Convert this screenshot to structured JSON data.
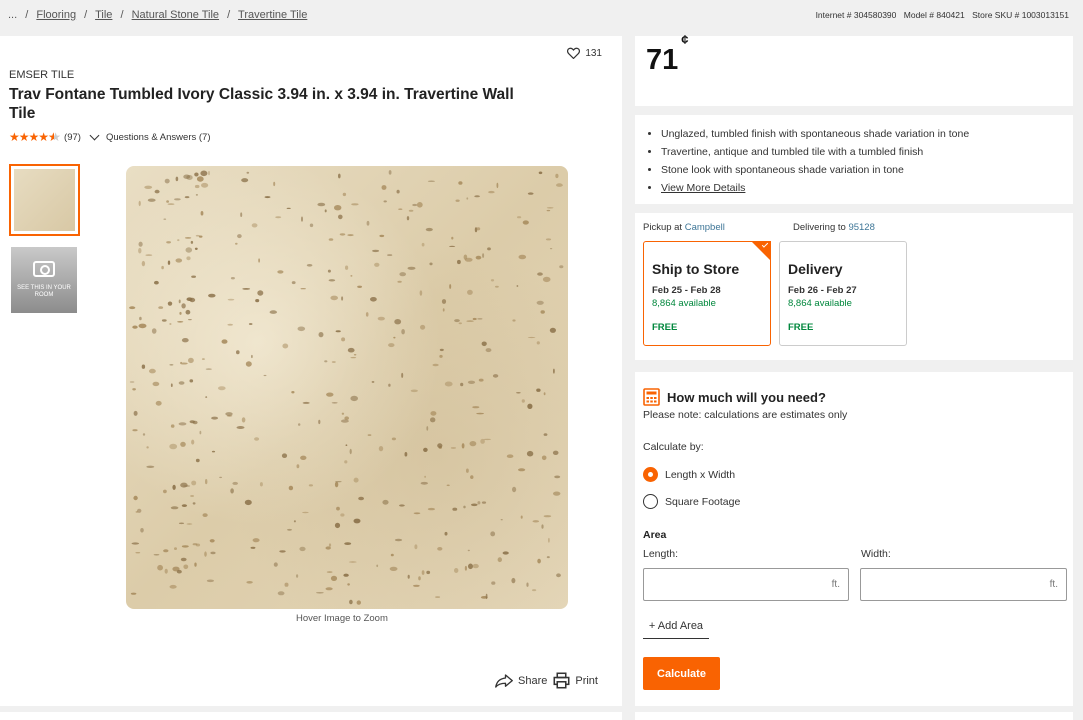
{
  "breadcrumb": {
    "ellipsis": "...",
    "separator": "/",
    "items": [
      "Flooring",
      "Tile",
      "Natural Stone Tile",
      "Travertine Tile"
    ]
  },
  "identifiers": {
    "internet": "Internet # 304580390",
    "model": "Model # 840421",
    "store_sku": "Store SKU # 1003013151"
  },
  "product": {
    "favorites_count": "131",
    "brand": "EMSER TILE",
    "title": "Trav Fontane Tumbled Ivory Classic 3.94 in. x 3.94 in. Travertine Wall Tile",
    "rating_stars": 4.5,
    "review_count": "(97)",
    "qa_label": "Questions & Answers (7)",
    "thumbnail_caption": "SEE THIS IN YOUR ROOM",
    "hover_text": "Hover Image to Zoom",
    "share_label": "Share",
    "print_label": "Print"
  },
  "price": {
    "value": "71",
    "unit": "¢"
  },
  "highlights": [
    "Unglazed, tumbled finish with spontaneous shade variation in tone",
    "Travertine, antique and tumbled tile with a tumbled finish",
    "Stone look with spontaneous shade variation in tone"
  ],
  "view_more_label": "View More Details",
  "fulfillment": {
    "pickup_prefix": "Pickup at",
    "pickup_store": "Campbell",
    "delivery_prefix": "Delivering to",
    "delivery_zip": "95128",
    "options": [
      {
        "title": "Ship to Store",
        "dates": "Feb 25 - Feb 28",
        "available": "8,864 available",
        "price": "FREE",
        "selected": true
      },
      {
        "title": "Delivery",
        "dates": "Feb 26 - Feb 27",
        "available": "8,864 available",
        "price": "FREE",
        "selected": false
      }
    ]
  },
  "calculator": {
    "heading": "How much will you need?",
    "note": "Please note: calculations are estimates only",
    "calc_by_label": "Calculate by:",
    "options": [
      "Length x Width",
      "Square Footage"
    ],
    "selected_option": "Length x Width",
    "area_label": "Area",
    "length_label": "Length:",
    "width_label": "Width:",
    "length_value": "",
    "width_value": "",
    "unit": "ft.",
    "add_area_label": "+ Add Area",
    "button_label": "Calculate"
  },
  "colors": {
    "accent": "#f96302",
    "available": "#00873c",
    "link": "#3e7697"
  }
}
